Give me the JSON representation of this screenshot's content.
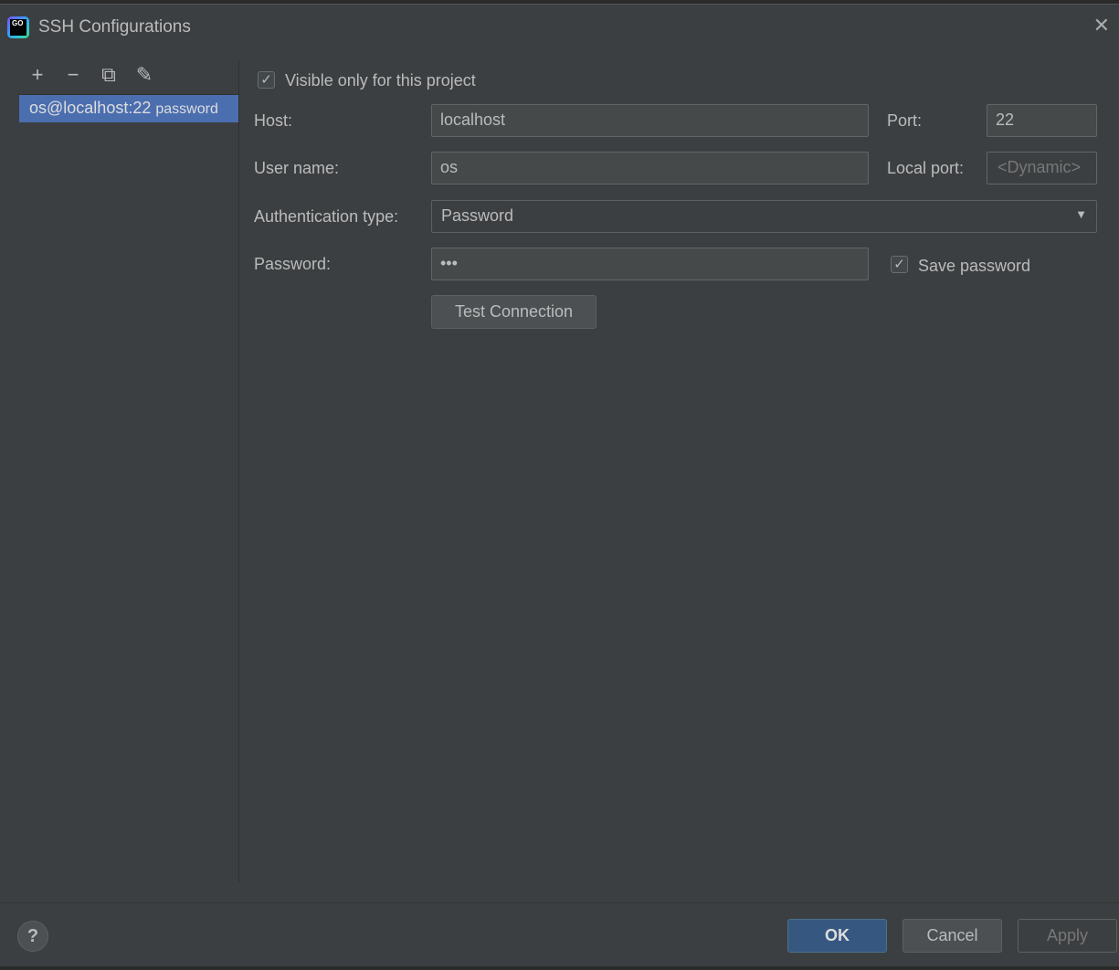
{
  "window": {
    "title": "SSH Configurations",
    "logo_text": "GO"
  },
  "toolbar": {
    "add": "+",
    "remove": "−",
    "copy": "⧉",
    "edit": "✎"
  },
  "list": {
    "items": [
      {
        "name": "os@localhost:22",
        "auth": "password",
        "selected": true
      }
    ]
  },
  "form": {
    "visible_only_label": "Visible only for this project",
    "visible_only_checked": true,
    "host_label": "Host:",
    "host_value": "localhost",
    "port_label": "Port:",
    "port_value": "22",
    "user_label": "User name:",
    "user_value": "os",
    "local_port_label": "Local port:",
    "local_port_placeholder": "<Dynamic>",
    "auth_label": "Authentication type:",
    "auth_value": "Password",
    "password_label": "Password:",
    "password_value": "•••",
    "save_password_label": "Save password",
    "save_password_checked": true,
    "test_connection": "Test Connection"
  },
  "footer": {
    "help": "?",
    "ok": "OK",
    "cancel": "Cancel",
    "apply": "Apply"
  }
}
